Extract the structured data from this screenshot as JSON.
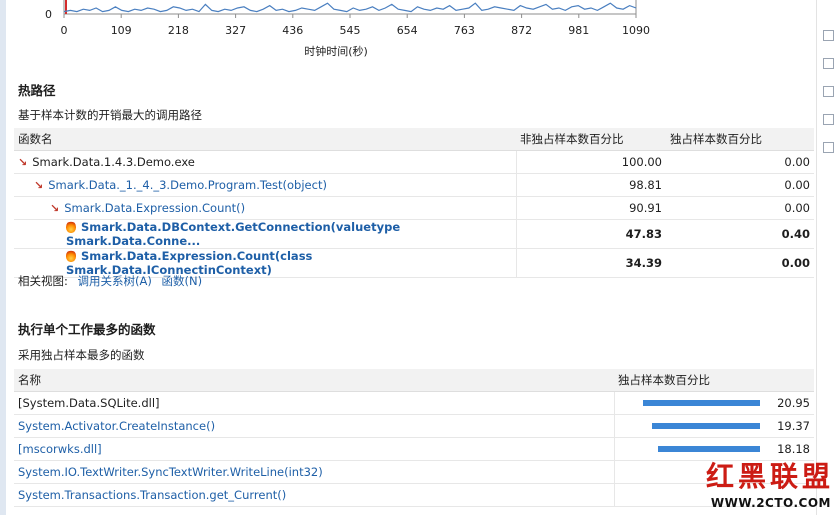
{
  "chart_data": {
    "type": "line",
    "title": "",
    "xlabel": "时钟时间(秒)",
    "ylabel": "",
    "x_ticks": [
      "0",
      "109",
      "218",
      "327",
      "436",
      "545",
      "654",
      "763",
      "872",
      "981",
      "1090"
    ],
    "y_ticks": [
      "0"
    ],
    "xlim": [
      0,
      1090
    ],
    "series": [
      {
        "values": [
          2,
          3,
          2,
          4,
          3,
          5,
          2,
          3,
          6,
          3,
          2,
          4,
          3,
          5,
          4,
          2,
          3,
          6,
          5,
          3,
          4,
          2,
          8,
          3,
          2,
          4,
          3,
          5,
          6,
          3,
          2,
          4,
          7,
          3,
          4,
          2,
          3,
          5,
          4,
          3,
          6,
          9,
          4,
          3,
          2,
          5,
          3,
          4,
          6,
          3,
          5,
          8,
          4,
          3,
          2,
          6,
          4,
          3,
          5,
          4,
          7,
          3,
          4,
          5,
          9,
          3,
          4,
          6,
          5,
          4,
          3,
          7,
          5,
          4,
          6,
          8,
          4,
          5,
          3,
          6,
          7,
          4,
          5,
          3,
          6,
          9,
          5,
          4,
          7,
          5
        ]
      }
    ],
    "color": "#4a7fc0"
  },
  "hot_path": {
    "title": "热路径",
    "subtitle": "基于样本计数的开销最大的调用路径",
    "columns": [
      "函数名",
      "非独占样本数百分比",
      "独占样本数百分比"
    ],
    "rows": [
      {
        "name": "Smark.Data.1.4.3.Demo.exe",
        "inclusive": "100.00",
        "exclusive": "0.00",
        "icon": "arrow-icon",
        "indent": 0,
        "bold": false,
        "link": false
      },
      {
        "name": "Smark.Data._1._4._3.Demo.Program.Test(object)",
        "inclusive": "98.81",
        "exclusive": "0.00",
        "icon": "arrow-icon",
        "indent": 1,
        "bold": false,
        "link": true
      },
      {
        "name": "Smark.Data.Expression.Count()",
        "inclusive": "90.91",
        "exclusive": "0.00",
        "icon": "arrow-icon",
        "indent": 2,
        "bold": false,
        "link": true
      },
      {
        "name": "Smark.Data.DBContext.GetConnection(valuetype Smark.Data.Conne...",
        "inclusive": "47.83",
        "exclusive": "0.40",
        "icon": "flame-icon",
        "indent": 3,
        "bold": true,
        "link": true
      },
      {
        "name": "Smark.Data.Expression.Count(class Smark.Data.IConnectinContext)",
        "inclusive": "34.39",
        "exclusive": "0.00",
        "icon": "flame-icon",
        "indent": 3,
        "bold": true,
        "link": true
      }
    ],
    "related_label": "相关视图:",
    "related_links": [
      "调用关系树(A)",
      "函数(N)"
    ]
  },
  "top_functions": {
    "title": "执行单个工作最多的函数",
    "subtitle": "采用独占样本最多的函数",
    "columns": [
      "名称",
      "独占样本数百分比"
    ],
    "rows": [
      {
        "name": "[System.Data.SQLite.dll]",
        "value": 20.95,
        "label": "20.95",
        "link": false
      },
      {
        "name": "System.Activator.CreateInstance()",
        "value": 19.37,
        "label": "19.37",
        "link": true
      },
      {
        "name": "[mscorwks.dll]",
        "value": 18.18,
        "label": "18.18",
        "link": true
      },
      {
        "name": "System.IO.TextWriter.SyncTextWriter.WriteLine(int32)",
        "value": null,
        "label": "",
        "link": true
      },
      {
        "name": "System.Transactions.Transaction.get_Current()",
        "value": null,
        "label": "",
        "link": true
      }
    ]
  },
  "watermark": {
    "text1": "红黑联盟",
    "text2": "WWW.2CTO.COM"
  }
}
